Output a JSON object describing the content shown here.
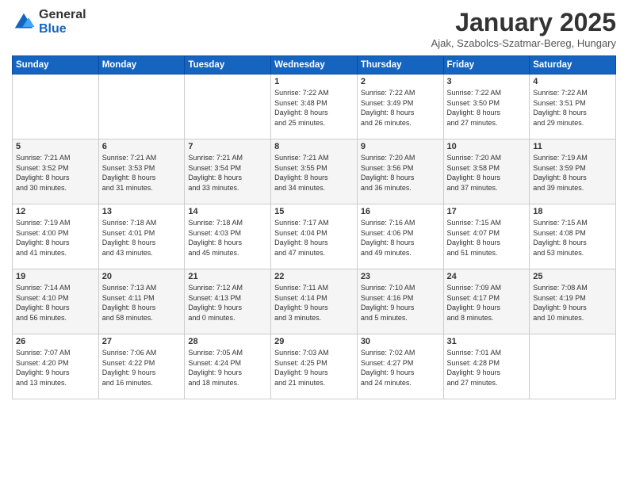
{
  "header": {
    "logo_general": "General",
    "logo_blue": "Blue",
    "title": "January 2025",
    "subtitle": "Ajak, Szabolcs-Szatmar-Bereg, Hungary"
  },
  "weekdays": [
    "Sunday",
    "Monday",
    "Tuesday",
    "Wednesday",
    "Thursday",
    "Friday",
    "Saturday"
  ],
  "weeks": [
    [
      {
        "day": "",
        "info": ""
      },
      {
        "day": "",
        "info": ""
      },
      {
        "day": "",
        "info": ""
      },
      {
        "day": "1",
        "info": "Sunrise: 7:22 AM\nSunset: 3:48 PM\nDaylight: 8 hours\nand 25 minutes."
      },
      {
        "day": "2",
        "info": "Sunrise: 7:22 AM\nSunset: 3:49 PM\nDaylight: 8 hours\nand 26 minutes."
      },
      {
        "day": "3",
        "info": "Sunrise: 7:22 AM\nSunset: 3:50 PM\nDaylight: 8 hours\nand 27 minutes."
      },
      {
        "day": "4",
        "info": "Sunrise: 7:22 AM\nSunset: 3:51 PM\nDaylight: 8 hours\nand 29 minutes."
      }
    ],
    [
      {
        "day": "5",
        "info": "Sunrise: 7:21 AM\nSunset: 3:52 PM\nDaylight: 8 hours\nand 30 minutes."
      },
      {
        "day": "6",
        "info": "Sunrise: 7:21 AM\nSunset: 3:53 PM\nDaylight: 8 hours\nand 31 minutes."
      },
      {
        "day": "7",
        "info": "Sunrise: 7:21 AM\nSunset: 3:54 PM\nDaylight: 8 hours\nand 33 minutes."
      },
      {
        "day": "8",
        "info": "Sunrise: 7:21 AM\nSunset: 3:55 PM\nDaylight: 8 hours\nand 34 minutes."
      },
      {
        "day": "9",
        "info": "Sunrise: 7:20 AM\nSunset: 3:56 PM\nDaylight: 8 hours\nand 36 minutes."
      },
      {
        "day": "10",
        "info": "Sunrise: 7:20 AM\nSunset: 3:58 PM\nDaylight: 8 hours\nand 37 minutes."
      },
      {
        "day": "11",
        "info": "Sunrise: 7:19 AM\nSunset: 3:59 PM\nDaylight: 8 hours\nand 39 minutes."
      }
    ],
    [
      {
        "day": "12",
        "info": "Sunrise: 7:19 AM\nSunset: 4:00 PM\nDaylight: 8 hours\nand 41 minutes."
      },
      {
        "day": "13",
        "info": "Sunrise: 7:18 AM\nSunset: 4:01 PM\nDaylight: 8 hours\nand 43 minutes."
      },
      {
        "day": "14",
        "info": "Sunrise: 7:18 AM\nSunset: 4:03 PM\nDaylight: 8 hours\nand 45 minutes."
      },
      {
        "day": "15",
        "info": "Sunrise: 7:17 AM\nSunset: 4:04 PM\nDaylight: 8 hours\nand 47 minutes."
      },
      {
        "day": "16",
        "info": "Sunrise: 7:16 AM\nSunset: 4:06 PM\nDaylight: 8 hours\nand 49 minutes."
      },
      {
        "day": "17",
        "info": "Sunrise: 7:15 AM\nSunset: 4:07 PM\nDaylight: 8 hours\nand 51 minutes."
      },
      {
        "day": "18",
        "info": "Sunrise: 7:15 AM\nSunset: 4:08 PM\nDaylight: 8 hours\nand 53 minutes."
      }
    ],
    [
      {
        "day": "19",
        "info": "Sunrise: 7:14 AM\nSunset: 4:10 PM\nDaylight: 8 hours\nand 56 minutes."
      },
      {
        "day": "20",
        "info": "Sunrise: 7:13 AM\nSunset: 4:11 PM\nDaylight: 8 hours\nand 58 minutes."
      },
      {
        "day": "21",
        "info": "Sunrise: 7:12 AM\nSunset: 4:13 PM\nDaylight: 9 hours\nand 0 minutes."
      },
      {
        "day": "22",
        "info": "Sunrise: 7:11 AM\nSunset: 4:14 PM\nDaylight: 9 hours\nand 3 minutes."
      },
      {
        "day": "23",
        "info": "Sunrise: 7:10 AM\nSunset: 4:16 PM\nDaylight: 9 hours\nand 5 minutes."
      },
      {
        "day": "24",
        "info": "Sunrise: 7:09 AM\nSunset: 4:17 PM\nDaylight: 9 hours\nand 8 minutes."
      },
      {
        "day": "25",
        "info": "Sunrise: 7:08 AM\nSunset: 4:19 PM\nDaylight: 9 hours\nand 10 minutes."
      }
    ],
    [
      {
        "day": "26",
        "info": "Sunrise: 7:07 AM\nSunset: 4:20 PM\nDaylight: 9 hours\nand 13 minutes."
      },
      {
        "day": "27",
        "info": "Sunrise: 7:06 AM\nSunset: 4:22 PM\nDaylight: 9 hours\nand 16 minutes."
      },
      {
        "day": "28",
        "info": "Sunrise: 7:05 AM\nSunset: 4:24 PM\nDaylight: 9 hours\nand 18 minutes."
      },
      {
        "day": "29",
        "info": "Sunrise: 7:03 AM\nSunset: 4:25 PM\nDaylight: 9 hours\nand 21 minutes."
      },
      {
        "day": "30",
        "info": "Sunrise: 7:02 AM\nSunset: 4:27 PM\nDaylight: 9 hours\nand 24 minutes."
      },
      {
        "day": "31",
        "info": "Sunrise: 7:01 AM\nSunset: 4:28 PM\nDaylight: 9 hours\nand 27 minutes."
      },
      {
        "day": "",
        "info": ""
      }
    ]
  ]
}
